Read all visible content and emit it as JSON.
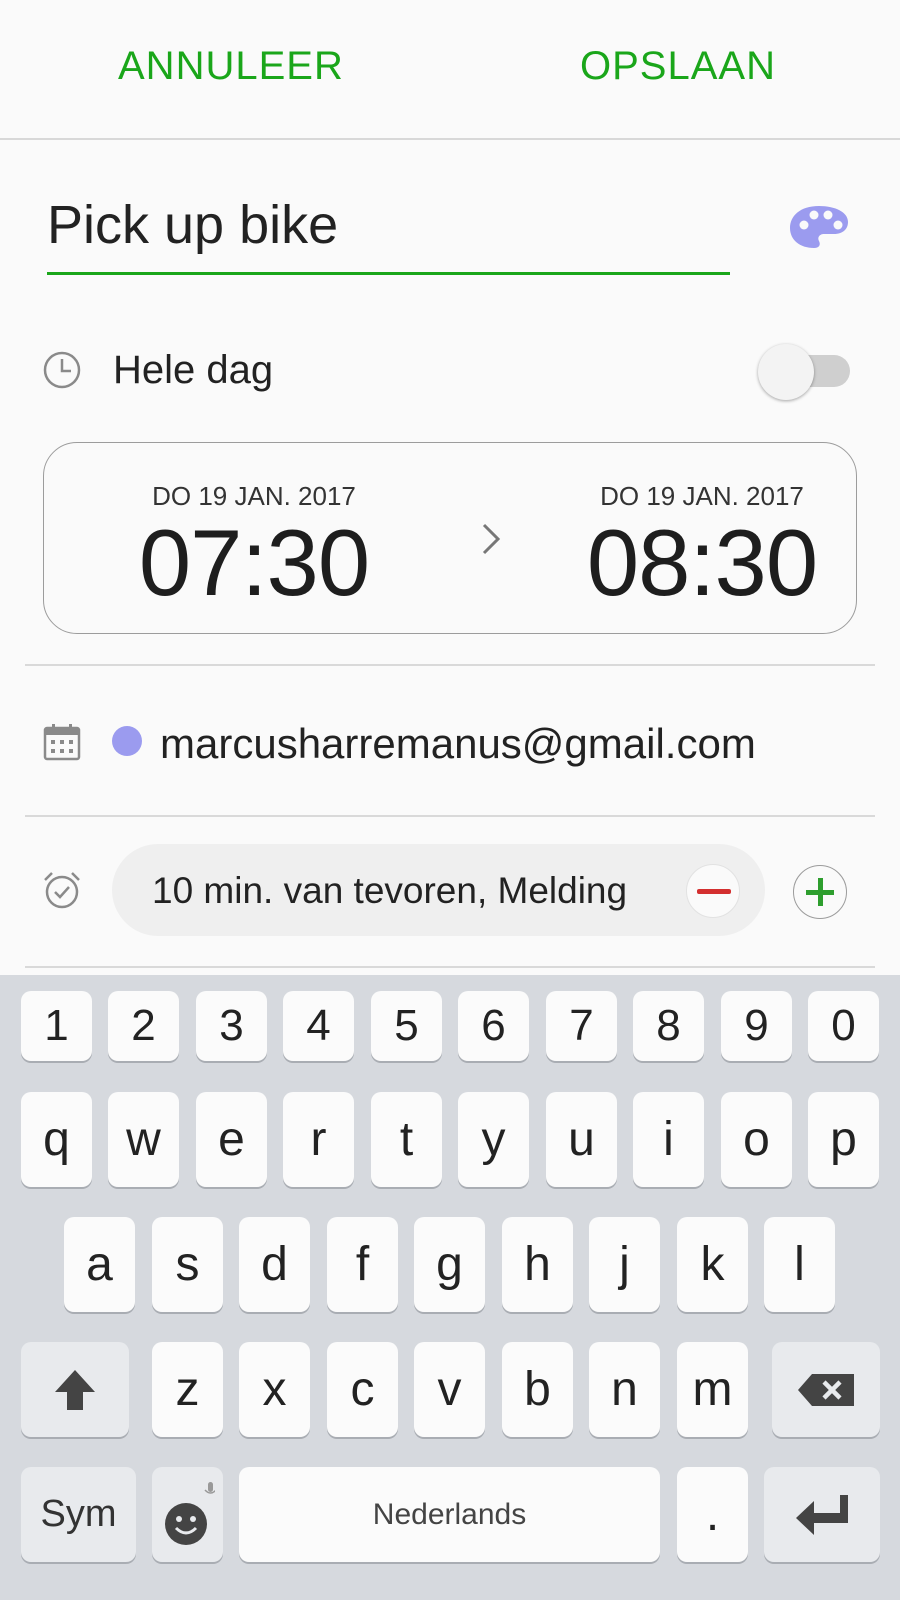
{
  "header": {
    "cancel_label": "ANNULEER",
    "save_label": "OPSLAAN"
  },
  "event": {
    "title_value": "Pick up bike"
  },
  "all_day": {
    "label": "Hele dag",
    "enabled": false
  },
  "time": {
    "start_date": "DO 19 JAN. 2017",
    "start_time": "07:30",
    "end_date": "DO 19 JAN. 2017",
    "end_time": "08:30"
  },
  "account": {
    "email": "marcusharremanus@gmail.com",
    "color": "#9b9bef"
  },
  "reminder": {
    "label": "10 min. van tevoren, Melding"
  },
  "keyboard": {
    "numbers": [
      "1",
      "2",
      "3",
      "4",
      "5",
      "6",
      "7",
      "8",
      "9",
      "0"
    ],
    "row1": [
      "q",
      "w",
      "e",
      "r",
      "t",
      "y",
      "u",
      "i",
      "o",
      "p"
    ],
    "row2": [
      "a",
      "s",
      "d",
      "f",
      "g",
      "h",
      "j",
      "k",
      "l"
    ],
    "row3": [
      "z",
      "x",
      "c",
      "v",
      "b",
      "n",
      "m"
    ],
    "sym_label": "Sym",
    "space_label": "Nederlands",
    "period_label": "."
  },
  "colors": {
    "accent": "#1aa61a",
    "palette": "#9b9bef",
    "remove": "#d32f2f"
  }
}
